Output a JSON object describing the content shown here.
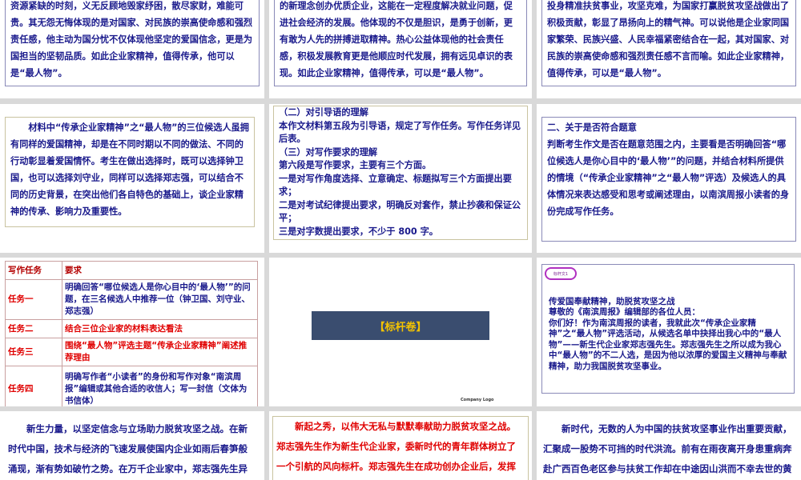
{
  "slides": {
    "s1": "资源紧缺的时刻，义无反顾地毁家纾困，散尽家财，难能可贵。其无怨无悔体现的是对国家、对民族的崇高使命感和强烈责任感，他主动为国分忧不仅体现他坚定的爱国信念，更是为国担当的坚韧品质。如此企业家精神，值得传承，他可以是“最人物”。",
    "s2": "的新理念创办优质企业，这能在一定程度解决就业问题，促进社会经济的发展。他体现的不仅是胆识，是勇于创新，更有敢为人先的拼搏进取精神。热心公益体现他的社会责任感，积极发展教育更是他顺应时代发展，拥有远见卓识的表现。如此企业家精神，值得传承，可以是“最人物”。",
    "s3": "投身精准扶贫事业，攻坚克难，为国家打赢脱贫攻坚战做出了积极贡献，彰显了昂扬向上的精气神。可以说他是企业家同国家繁荣、民族兴盛、人民幸福紧密结合在一起，其对国家、对民族的崇高使命感和强烈责任感不言而喻。如此企业家精神，值得传承，可以是“最人物”。",
    "s4": "材料中“传承企业家精神”之“最人物”的三位候选人虽拥有同样的爱国精神，却是在不同时期以不同的做法、不同的行动彰显着爱国情怀。考生在做出选择时，既可以选择钟卫国，也可以选择刘守业，同样可以选择郑志强，可以结合不同的历史背景，在突出他们各自特色的基础上，谈企业家精神的传承、影响力及重要性。",
    "s5": "（二）对引导语的理解\n本作文材料第五段为引导语，规定了写作任务。写作任务详见后表。\n（三）对写作要求的理解\n第六段是写作要求，主要有三个方面。\n一是对写作角度选择、立意确定、标题拟写三个方面提出要求；\n二是对考试纪律提出要求，明确反对套作，禁止抄袭和保证公平；\n三是对字数提出要求，不少于 800 字。",
    "s6": "二、关于是否符合题意\n判断考生作文是否在题意范围之内，主要看是否明确回答“哪位候选人是你心目中的‘最人物’”的问题，并结合材料所提供的情境（“传承企业家精神”之“最人物”评选）及候选人的具体情况来表达感受和思考或阐述理由，以南滨周报小读者的身份完成写作任务。",
    "task_table": [
      [
        "写作任务",
        "要求"
      ],
      [
        "任务一",
        "明确回答“哪位候选人是你心目中的‘最人物’”的问题，在三名候选人中推荐一位（钟卫国、刘守业、郑志强）"
      ],
      [
        "任务二",
        "结合三位企业家的材料表达看法"
      ],
      [
        "任务三",
        "围绕“最人物”评选主题“传承企业家精神”阐述推荐理由"
      ],
      [
        "任务四",
        "明确写作者“小读者”的身份和写作对象“南滨周报”编辑或其他合适的收信人；写一封信（文体为书信体）"
      ]
    ],
    "s8_button": "【标杆卷】",
    "s8_logo": "Company Logo",
    "s9_badge": "标杆文1",
    "s9": "传爱国奉献精神，助脱贫攻坚之战\n尊敬的《南滨周报》编辑部的各位人员：\n你们好！作为南滨周报的读者，我就此次“传承企业家精神”之“最人物”评选活动，从候选名单中抉择出我心中的“最人物”——新生代企业家郑志强先生。郑志强先生之所以成为我心中“最人物”的不二人选，是因为他以浓厚的爱国主义精神与奉献精神，助力我国脱贫攻坚事业。",
    "s10": "新生力量，以坚定信念与立场助力脱贫攻坚之战。在新时代中国，技术与经济的飞速发展使国内企业如雨后春笋般涌现，渐有势如破竹之势。在万千企业家中，郑志强先生异军突起，作为新生代企业家，在积累了资源与财富后，他并没有抽身乡到城市",
    "s11": "新起之秀，以伟大无私与默默奉献助力脱贫攻坚之战。郑志强先生作为新生代企业家，委新时代的青年群体树立了一个引航的风向标杆。郑志强先生在成功创办企业后，发挥其自身影响力，凝聚企业家的力量，用小我的“财富”创造大我的“财富”，郑",
    "s12": "新时代，无数的人为中国的扶贫攻坚事业作出重要贡献，汇聚成一股势不可挡的时代洪流。前有在雨夜离开身患重病奔赴广西百色老区参与扶贫工作却在中途因山洪而不幸去世的黄文秀；有引领村民在悬崖峭壁上凿山开出致富路的毛相林；有失去四肢"
  }
}
